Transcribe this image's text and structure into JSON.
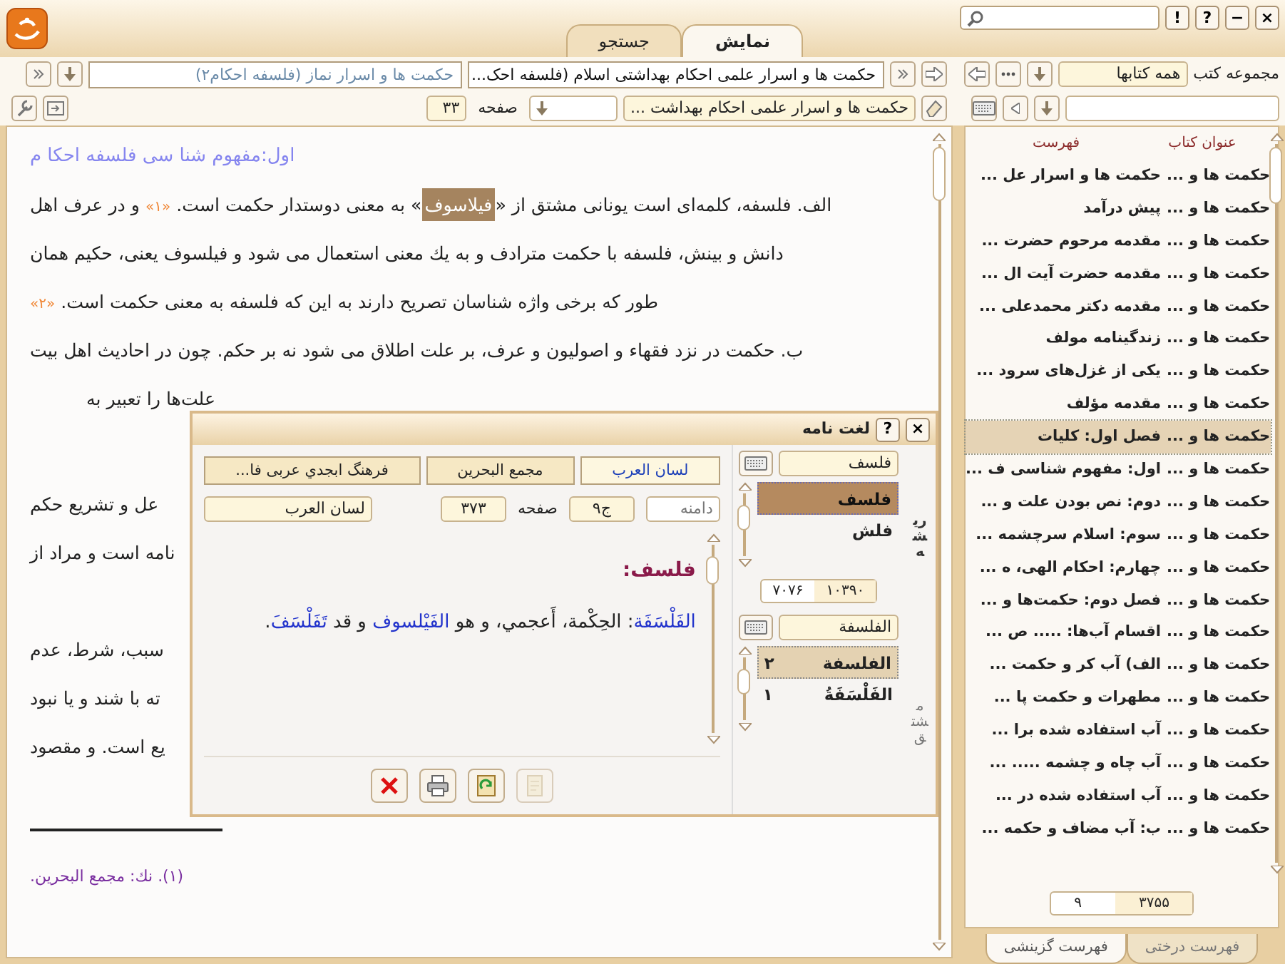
{
  "window_buttons": [
    "×",
    "−",
    "?",
    "!"
  ],
  "tabs": [
    {
      "label": "نمایش",
      "selected": true
    },
    {
      "label": "جستجو",
      "selected": false
    }
  ],
  "doc_tabs": [
    {
      "title": "حکمت ها و اسرار علمی احکام بهداشتی اسلام (فلسفه احک...",
      "selected": true
    },
    {
      "title": "حکمت ها و اسرار نماز (فلسفه احکام۲)",
      "selected": false
    }
  ],
  "nav": {
    "book": "حکمت ها و اسرار علمی احکام بهداشت ...",
    "page_label": "صفحه",
    "page": "۳۳"
  },
  "content": {
    "title": "اول:مفهوم شنا سی فلسفه احکا م",
    "lines": [
      {
        "kind": "full",
        "segments": [
          {
            "kind": "plain",
            "text": "الف. فلسفه، کلمه‌ای است یونانی مشتق از «"
          },
          {
            "kind": "highlight",
            "text": "فیلاسوف"
          },
          {
            "kind": "plain",
            "text": "» به معنی دوستدار حکمت است. "
          },
          {
            "kind": "note",
            "text": "«۱»"
          },
          {
            "kind": "plain",
            "text": " و در عرف اهل"
          }
        ]
      },
      {
        "kind": "full",
        "segments": [
          {
            "kind": "plain",
            "text": "دانش و بینش، فلسفه با حکمت مترادف و به یك معنی استعمال می شود و فیلسوف یعنی، حکیم همان"
          }
        ]
      },
      {
        "kind": "full",
        "segments": [
          {
            "kind": "plain",
            "text": "طور که برخی واژه  شناسان تصریح دارند به این که فلسفه به معنی حکمت است. "
          },
          {
            "kind": "note",
            "text": "«۲»"
          }
        ]
      },
      {
        "kind": "full",
        "segments": [
          {
            "kind": "plain",
            "text": "ب. حکمت در نزد فقهاء و اصولیون و عرف، بر علت اطلاق می شود نه بر حکم. چون در احادیث اهل بیت"
          }
        ]
      },
      {
        "kind": "partial",
        "segments": [
          {
            "kind": "plain",
            "text": "علت‌ها را تعبیر به"
          }
        ]
      }
    ],
    "covered_paragraphs": [
      [
        "عل و تشریع حکم",
        "نامه است و مراد از"
      ],
      [
        "سبب، شرط، عدم",
        "ته با شند و یا نبود",
        "یع است. و مقصود"
      ]
    ],
    "footnote": "(۱). نك: مجمع البحرين."
  },
  "dialog": {
    "title": "لغت نامه",
    "buttons": [
      "×",
      "?"
    ],
    "side_tabs": [
      {
        "label": "ریشه",
        "selected": true
      },
      {
        "label": "مشتق",
        "selected": false
      }
    ],
    "root_query": "فلسف",
    "roots": [
      {
        "text": "فلسف",
        "selected": true
      },
      {
        "text": "فلش",
        "selected": false
      }
    ],
    "counter": {
      "total": "۱۰۳۹۰",
      "current": "۷۰۷۶"
    },
    "derived_query": "الفلسفة",
    "derived": [
      {
        "text": "الفلسفة",
        "count": "۲",
        "selected": true
      },
      {
        "text": "الفَلْسَفَةُ",
        "count": "۱",
        "selected": false
      }
    ],
    "dictionaries": [
      {
        "label": "لسان العرب",
        "selected": true
      },
      {
        "label": "مجمع البحرين",
        "selected": false
      },
      {
        "label": "فرهنگ ابجدي عربی فا...",
        "selected": false
      }
    ],
    "scope_label": "دامنه",
    "volume": "ج۹",
    "page_label": "صفحه",
    "page": "۳۷۳",
    "source": "لسان العرب",
    "headword": "فلسف:",
    "definition": [
      {
        "kind": "term",
        "text": "الفَلْسَفَة"
      },
      {
        "kind": "plain",
        "text": ": الحِكْمة، أَعجمي، و هو "
      },
      {
        "kind": "term",
        "text": "الفَيْلسوف"
      },
      {
        "kind": "plain",
        "text": " و قد "
      },
      {
        "kind": "term",
        "text": "تَفَلْسَفَ"
      },
      {
        "kind": "plain",
        "text": "."
      }
    ],
    "actions": [
      {
        "kind": "close",
        "disabled": false
      },
      {
        "kind": "print",
        "disabled": false
      },
      {
        "kind": "refresh",
        "disabled": false
      },
      {
        "kind": "document",
        "disabled": true
      }
    ]
  },
  "sidebar": {
    "collection_label": "مجموعه کتب",
    "collection": "همه کتابها",
    "columns": [
      "عنوان کتاب",
      "فهرست"
    ],
    "rows": [
      {
        "book": "حکمت ها و ...",
        "entry": "حکمت ها و اسرار عل ...",
        "selected": false
      },
      {
        "book": "حکمت ها و ...",
        "entry": "پیش درآمد",
        "selected": false
      },
      {
        "book": "حکمت ها و ...",
        "entry": "مقدمه مرحوم حضرت ...",
        "selected": false
      },
      {
        "book": "حکمت ها و ...",
        "entry": "مقدمه حضرت آیت ال ...",
        "selected": false
      },
      {
        "book": "حکمت ها و ...",
        "entry": "مقدمه دکتر محمدعلی ...",
        "selected": false
      },
      {
        "book": "حکمت ها و ...",
        "entry": "زندگینامه مولف",
        "selected": false
      },
      {
        "book": "حکمت ها و ...",
        "entry": "یکی از غزل‌های سرود ...",
        "selected": false
      },
      {
        "book": "حکمت ها و ...",
        "entry": "مقدمه مؤلف",
        "selected": false
      },
      {
        "book": "حکمت ها و ...",
        "entry": "فصل اول: کلیات",
        "selected": true
      },
      {
        "book": "حکمت ها و ...",
        "entry": "اول: مفهوم شناسی ف ...",
        "selected": false
      },
      {
        "book": "حکمت ها و ...",
        "entry": "دوم: نص بودن علت و ...",
        "selected": false
      },
      {
        "book": "حکمت ها و ...",
        "entry": "سوم: اسلام سرچشمه ...",
        "selected": false
      },
      {
        "book": "حکمت ها و ...",
        "entry": "چهارم: احکام الهی، ه ...",
        "selected": false
      },
      {
        "book": "حکمت ها و ...",
        "entry": "فصل دوم: حکمت‌ها و ...",
        "selected": false
      },
      {
        "book": "حکمت ها و ...",
        "entry": "اقسام آب‌ها: ..... ص ...",
        "selected": false
      },
      {
        "book": "حکمت ها و ...",
        "entry": "الف) آب کر و حکمت ...",
        "selected": false
      },
      {
        "book": "حکمت ها و ...",
        "entry": "مطهرات و حکمت پا ...",
        "selected": false
      },
      {
        "book": "حکمت ها و ...",
        "entry": "آب استفاده شده برا ...",
        "selected": false
      },
      {
        "book": "حکمت ها و ...",
        "entry": "آب چاه و چشمه ..... ...",
        "selected": false
      },
      {
        "book": "حکمت ها و ...",
        "entry": "آب استفاده شده در ...",
        "selected": false
      },
      {
        "book": "حکمت ها و ...",
        "entry": "ب: آب مضاف و حکمه ...",
        "selected": false
      }
    ],
    "pager": {
      "total": "۳۷۵۵",
      "current": "۹"
    },
    "tabs": [
      {
        "label": "فهرست درختی",
        "selected": false
      },
      {
        "label": "فهرست گزینشی",
        "selected": true
      }
    ]
  }
}
